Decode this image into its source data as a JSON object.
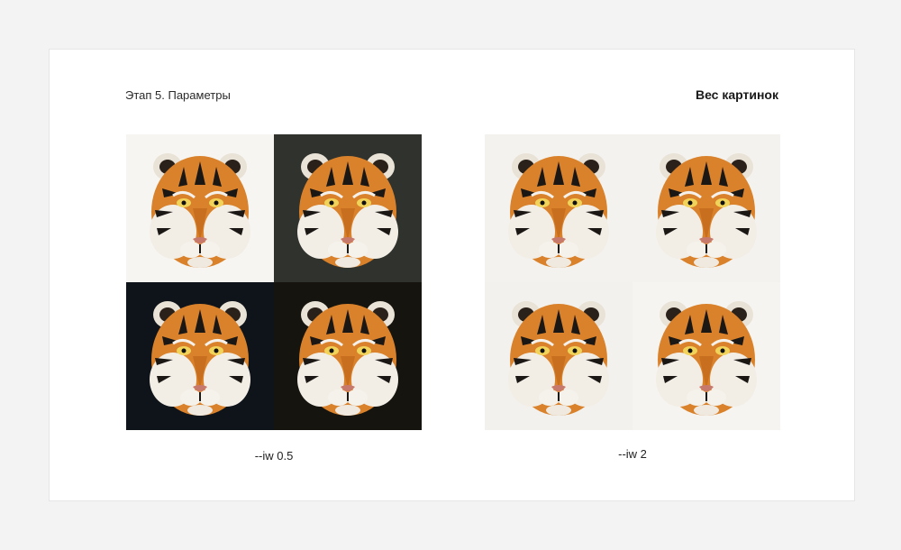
{
  "header": {
    "step_label": "Этап 5. Параметры",
    "title": "Вес картинок"
  },
  "examples": [
    {
      "caption": "--iw 0.5",
      "images": [
        {
          "subject": "tiger-portrait",
          "background": "#f7f5f2"
        },
        {
          "subject": "tiger-portrait",
          "background": "#2f322d"
        },
        {
          "subject": "tiger-portrait",
          "background": "#0f141a"
        },
        {
          "subject": "tiger-portrait",
          "background": "#15140f"
        }
      ]
    },
    {
      "caption": "--iw 2",
      "images": [
        {
          "subject": "tiger-portrait",
          "background": "#f4f2ee"
        },
        {
          "subject": "tiger-portrait",
          "background": "#f4f2ee"
        },
        {
          "subject": "tiger-portrait",
          "background": "#f2f1ed"
        },
        {
          "subject": "tiger-portrait",
          "background": "#f6f4f0"
        }
      ]
    }
  ],
  "colors": {
    "page_background": "#f3f3f4",
    "card_background": "#ffffff",
    "tiger_orange": "#d9822b",
    "tiger_stripe": "#1b1714"
  }
}
